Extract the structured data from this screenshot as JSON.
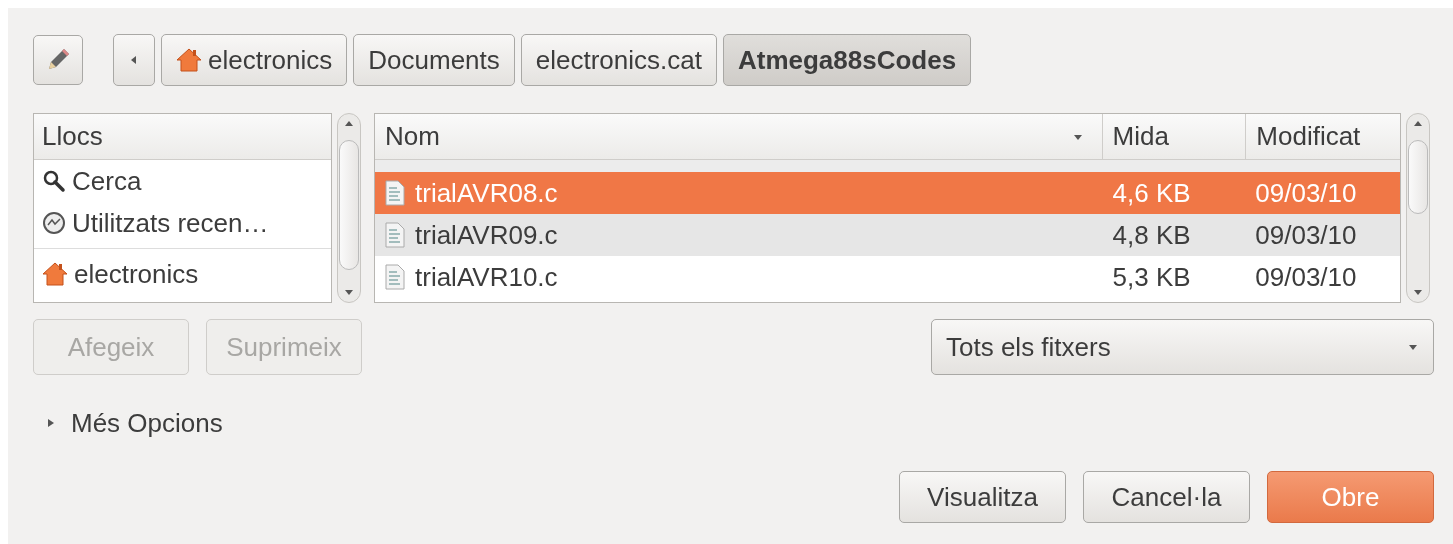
{
  "path": [
    {
      "label": "electronics",
      "kind": "home",
      "selected": false
    },
    {
      "label": "Documents",
      "kind": "plain",
      "selected": false
    },
    {
      "label": "electronics.cat",
      "kind": "plain",
      "selected": false
    },
    {
      "label": "Atmega88sCodes",
      "kind": "plain",
      "selected": true
    }
  ],
  "places": {
    "header": "Llocs",
    "items": [
      {
        "label": "Cerca",
        "kind": "search"
      },
      {
        "label": "Utilitzats recen…",
        "kind": "recent"
      },
      {
        "label": "electronics",
        "kind": "home"
      }
    ]
  },
  "place_buttons": [
    {
      "label": "Afegeix",
      "disabled": true
    },
    {
      "label": "Suprimeix",
      "disabled": true
    }
  ],
  "files": {
    "columns": [
      "Nom",
      "Mida",
      "Modificat"
    ],
    "rows": [
      {
        "name": "trialAVR08.c",
        "size": "4,6 KB",
        "modified": "09/03/10",
        "selected": true
      },
      {
        "name": "trialAVR09.c",
        "size": "4,8 KB",
        "modified": "09/03/10",
        "selected": false
      },
      {
        "name": "trialAVR10.c",
        "size": "5,3 KB",
        "modified": "09/03/10",
        "selected": false
      }
    ]
  },
  "filter": {
    "value": "Tots els fitxers"
  },
  "more_options": {
    "label": "Més Opcions",
    "expanded": false
  },
  "buttons": [
    {
      "label": "Visualitza",
      "default": false
    },
    {
      "label": "Cancel·la",
      "default": false
    },
    {
      "label": "Obre",
      "default": true
    }
  ]
}
